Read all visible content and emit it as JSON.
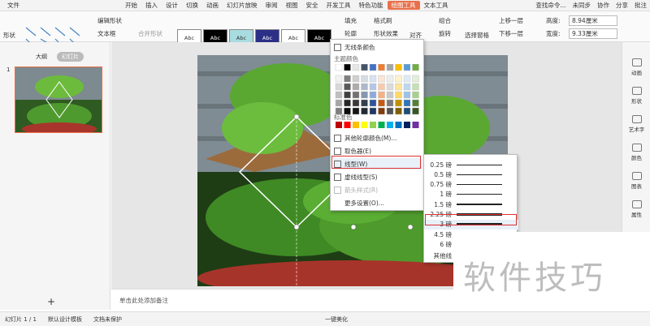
{
  "menubar": {
    "file": "文件",
    "items": [
      "开始",
      "插入",
      "设计",
      "切换",
      "动画",
      "幻灯片放映",
      "审阅",
      "视图",
      "安全",
      "开发工具",
      "特色功能",
      "绘图工具",
      "文本工具"
    ],
    "active_index": 11,
    "search": "查找命令...",
    "sync": "未同步",
    "collab": "协作",
    "share": "分享",
    "batch": "批注"
  },
  "ribbon": {
    "shape": "形状",
    "edit_shape": "编辑形状",
    "textbox": "文本框",
    "merge_shape": "合并形状",
    "swatches": [
      "Abc",
      "Abc",
      "Abc",
      "Abc",
      "Abc",
      "Abc"
    ],
    "swatch_colors": [
      "#ffffff",
      "#000000",
      "#a8dce0",
      "#2b2f86",
      "#ffffff",
      "#000000"
    ],
    "fill": "填充",
    "format_brush": "格式刷",
    "outline": "轮廓",
    "shape_effect": "形状效果",
    "align": "对齐",
    "group": "组合",
    "rotate": "旋转",
    "select_pane": "选择窗格",
    "up_one": "上移一层",
    "down_one": "下移一层",
    "height_label": "高度:",
    "height_value": "8.94厘米",
    "width_label": "宽度:",
    "width_value": "9.33厘米"
  },
  "leftpanel": {
    "tab_outline": "大纲",
    "tab_slides": "幻灯片",
    "slide_number": "1",
    "add_icon": "+"
  },
  "dropdown": {
    "no_outline": "无线条颜色",
    "theme_colors": "主题颜色",
    "standard_colors": "标准色",
    "more_outline": "其他轮廓颜色(M)...",
    "eyedropper": "取色器(E)",
    "line_weight": "线型(W)",
    "dash": "虚线线型(S)",
    "arrow": "箭头样式(R)",
    "more_settings": "更多设置(O)..."
  },
  "theme_palette": [
    "#ffffff",
    "#000000",
    "#e7e6e6",
    "#44546a",
    "#4472c4",
    "#ed7d31",
    "#a5a5a5",
    "#ffc000",
    "#5b9bd5",
    "#70ad47",
    "#f2f2f2",
    "#7f7f7f",
    "#d0cece",
    "#d6dce4",
    "#d9e2f3",
    "#fbe5d5",
    "#ededed",
    "#fff2cc",
    "#deebf6",
    "#e2efd9",
    "#d8d8d8",
    "#595959",
    "#aeabab",
    "#adb9ca",
    "#b4c6e7",
    "#f7cbac",
    "#dbdbdb",
    "#fee599",
    "#bdd7ee",
    "#c5e0b3",
    "#bfbfbf",
    "#3f3f3f",
    "#757070",
    "#8496b0",
    "#8eaadb",
    "#f4b183",
    "#c9c9c9",
    "#ffd965",
    "#9cc3e5",
    "#a8d08d",
    "#a5a5a5",
    "#262626",
    "#3a3838",
    "#323f4f",
    "#2f5496",
    "#c55a11",
    "#7b7b7b",
    "#bf9000",
    "#2e75b5",
    "#538135",
    "#7f7f7f",
    "#0c0c0c",
    "#171616",
    "#222a35",
    "#1f3864",
    "#833c0b",
    "#525252",
    "#7f6000",
    "#1e4e79",
    "#375623"
  ],
  "standard_palette": [
    "#c00000",
    "#ff0000",
    "#ffc000",
    "#ffff00",
    "#92d050",
    "#00b050",
    "#00b0f0",
    "#0070c0",
    "#002060",
    "#7030a0"
  ],
  "weights": [
    {
      "label": "0.25 磅",
      "w": 0.25
    },
    {
      "label": "0.5 磅",
      "w": 0.5
    },
    {
      "label": "0.75 磅",
      "w": 0.75
    },
    {
      "label": "1 磅",
      "w": 1
    },
    {
      "label": "1.5 磅",
      "w": 1.5
    },
    {
      "label": "2.25 磅",
      "w": 2.25
    },
    {
      "label": "3 磅",
      "w": 3
    },
    {
      "label": "4.5 磅",
      "w": 4.5
    },
    {
      "label": "6 磅",
      "w": 6
    }
  ],
  "weights_more": "其他线",
  "selected_weight": "3 磅",
  "rightbar": [
    "动画",
    "形状",
    "艺术字",
    "颜色",
    "图表",
    "属性"
  ],
  "notes": "单击此处添加备注",
  "status": {
    "slide_count": "幻灯片 1 / 1",
    "template": "默认设计模板",
    "protect": "文档未保护",
    "beautify": "一键美化"
  },
  "watermark": "软件技巧"
}
